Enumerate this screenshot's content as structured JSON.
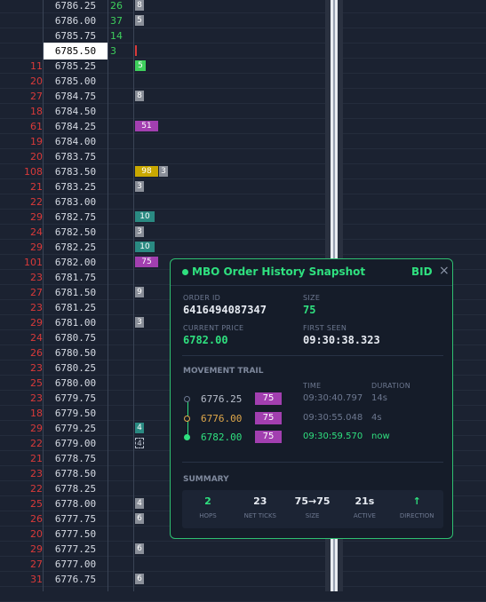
{
  "ladder": {
    "rows": [
      {
        "bid": "",
        "price": "6786.25",
        "ask": "26",
        "bar": {
          "label": "8",
          "color": "#8a8f99",
          "w": 10
        }
      },
      {
        "bid": "",
        "price": "6786.00",
        "ask": "37",
        "bar": {
          "label": "5",
          "color": "#8a8f99",
          "w": 10
        }
      },
      {
        "bid": "",
        "price": "6785.75",
        "ask": "14",
        "bar": null
      },
      {
        "bid": "",
        "price": "6785.50",
        "ask": "3",
        "current": true,
        "bar": {
          "label": "",
          "color": "#d93a3a",
          "w": 2
        }
      },
      {
        "bid": "11",
        "price": "6785.25",
        "ask": "",
        "bar": {
          "label": "5",
          "color": "#3ecf5c",
          "w": 12
        }
      },
      {
        "bid": "20",
        "price": "6785.00",
        "ask": "",
        "bar": null
      },
      {
        "bid": "27",
        "price": "6784.75",
        "ask": "",
        "bar": {
          "label": "8",
          "color": "#8a8f99",
          "w": 10
        }
      },
      {
        "bid": "18",
        "price": "6784.50",
        "ask": "",
        "bar": null
      },
      {
        "bid": "61",
        "price": "6784.25",
        "ask": "",
        "bar": {
          "label": "51",
          "color": "#a23fb0",
          "w": 26
        }
      },
      {
        "bid": "19",
        "price": "6784.00",
        "ask": "",
        "bar": null
      },
      {
        "bid": "20",
        "price": "6783.75",
        "ask": "",
        "bar": null
      },
      {
        "bid": "108",
        "price": "6783.50",
        "ask": "",
        "bar": {
          "label": "98",
          "color": "#c9a800",
          "w": 26
        },
        "bar2": {
          "label": "3",
          "color": "#8a8f99",
          "w": 10
        }
      },
      {
        "bid": "21",
        "price": "6783.25",
        "ask": "",
        "bar": {
          "label": "3",
          "color": "#8a8f99",
          "w": 10
        }
      },
      {
        "bid": "22",
        "price": "6783.00",
        "ask": "",
        "bar": null
      },
      {
        "bid": "29",
        "price": "6782.75",
        "ask": "",
        "bar": {
          "label": "10",
          "color": "#2a8a82",
          "w": 22
        }
      },
      {
        "bid": "24",
        "price": "6782.50",
        "ask": "",
        "bar": {
          "label": "3",
          "color": "#8a8f99",
          "w": 10
        }
      },
      {
        "bid": "29",
        "price": "6782.25",
        "ask": "",
        "bar": {
          "label": "10",
          "color": "#2a8a82",
          "w": 22
        }
      },
      {
        "bid": "101",
        "price": "6782.00",
        "ask": "",
        "bar": {
          "label": "75",
          "color": "#a23fb0",
          "w": 26
        }
      },
      {
        "bid": "23",
        "price": "6781.75",
        "ask": "",
        "bar": null
      },
      {
        "bid": "27",
        "price": "6781.50",
        "ask": "",
        "bar": {
          "label": "9",
          "color": "#8a8f99",
          "w": 10
        }
      },
      {
        "bid": "23",
        "price": "6781.25",
        "ask": "",
        "bar": null
      },
      {
        "bid": "29",
        "price": "6781.00",
        "ask": "",
        "bar": {
          "label": "3",
          "color": "#8a8f99",
          "w": 10
        }
      },
      {
        "bid": "24",
        "price": "6780.75",
        "ask": "",
        "bar": null
      },
      {
        "bid": "26",
        "price": "6780.50",
        "ask": "",
        "bar": null
      },
      {
        "bid": "23",
        "price": "6780.25",
        "ask": "",
        "bar": null
      },
      {
        "bid": "25",
        "price": "6780.00",
        "ask": "",
        "bar": null
      },
      {
        "bid": "23",
        "price": "6779.75",
        "ask": "",
        "bar": null
      },
      {
        "bid": "18",
        "price": "6779.50",
        "ask": "",
        "bar": null
      },
      {
        "bid": "29",
        "price": "6779.25",
        "ask": "",
        "bar": {
          "label": "4",
          "color": "#2a8a82",
          "w": 10
        }
      },
      {
        "bid": "22",
        "price": "6779.00",
        "ask": "",
        "bar": {
          "label": "4",
          "color": "#1b2231",
          "w": 10,
          "dashed": true
        }
      },
      {
        "bid": "21",
        "price": "6778.75",
        "ask": "",
        "bar": null
      },
      {
        "bid": "23",
        "price": "6778.50",
        "ask": "",
        "bar": null
      },
      {
        "bid": "22",
        "price": "6778.25",
        "ask": "",
        "bar": null
      },
      {
        "bid": "25",
        "price": "6778.00",
        "ask": "",
        "bar": {
          "label": "4",
          "color": "#8a8f99",
          "w": 10
        }
      },
      {
        "bid": "26",
        "price": "6777.75",
        "ask": "",
        "bar": {
          "label": "6",
          "color": "#8a8f99",
          "w": 10
        }
      },
      {
        "bid": "20",
        "price": "6777.50",
        "ask": "",
        "bar": null
      },
      {
        "bid": "29",
        "price": "6777.25",
        "ask": "",
        "bar": {
          "label": "6",
          "color": "#8a8f99",
          "w": 10
        }
      },
      {
        "bid": "27",
        "price": "6777.00",
        "ask": "",
        "bar": null
      },
      {
        "bid": "31",
        "price": "6776.75",
        "ask": "",
        "bar": {
          "label": "6",
          "color": "#8a8f99",
          "w": 10
        }
      },
      {
        "bid": "",
        "price": "",
        "ask": "",
        "bar": null
      }
    ]
  },
  "popup": {
    "title": "MBO Order History Snapshot",
    "side": "BID",
    "close_icon": "×",
    "order_id_label": "ORDER ID",
    "order_id": "6416494087347",
    "size_label": "SIZE",
    "size": "75",
    "current_price_label": "CURRENT PRICE",
    "current_price": "6782.00",
    "first_seen_label": "FIRST SEEN",
    "first_seen": "09:30:38.323",
    "trail_section": "MOVEMENT TRAIL",
    "time_header": "TIME",
    "duration_header": "DURATION",
    "trail": [
      {
        "price": "6776.25",
        "size": "75",
        "time": "09:30:40.797",
        "duration": "14s",
        "dot": "#6d7890",
        "color": "#b8bfcc",
        "time_color": "#6d7890"
      },
      {
        "price": "6776.00",
        "size": "75",
        "time": "09:30:55.048",
        "duration": "4s",
        "dot": "#e0a84a",
        "color": "#e0a84a",
        "time_color": "#6d7890"
      },
      {
        "price": "6782.00",
        "size": "75",
        "time": "09:30:59.570",
        "duration": "now",
        "dot": "#2fe07f",
        "color": "#2fe07f",
        "time_color": "#2fe07f"
      }
    ],
    "summary_section": "SUMMARY",
    "summary": [
      {
        "value": "2",
        "label": "HOPS",
        "green": true
      },
      {
        "value": "23",
        "label": "NET TICKS",
        "green": false
      },
      {
        "value": "75→75",
        "label": "SIZE",
        "green": false
      },
      {
        "value": "21s",
        "label": "ACTIVE",
        "green": false
      },
      {
        "value": "↑",
        "label": "DIRECTION",
        "green": true
      }
    ]
  }
}
